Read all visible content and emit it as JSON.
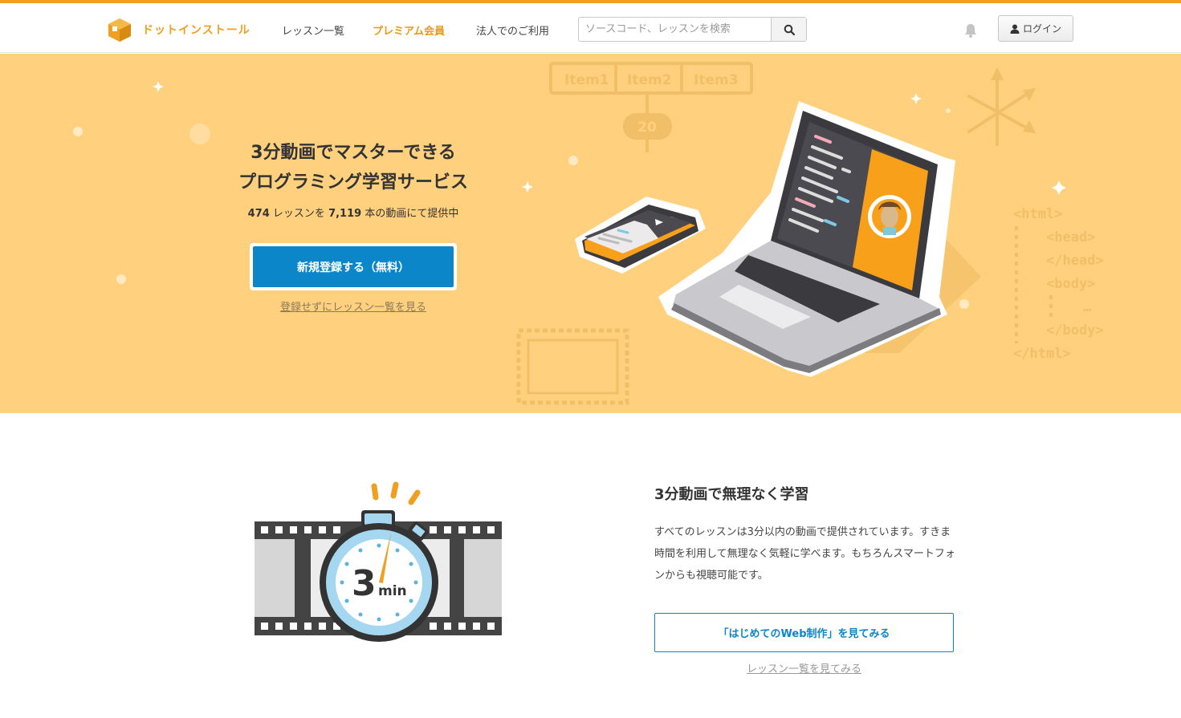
{
  "header": {
    "logo_text": "ドットインストール",
    "nav": [
      {
        "label": "レッスン一覧"
      },
      {
        "label": "プレミアム会員"
      },
      {
        "label": "法人でのご利用"
      }
    ],
    "search": {
      "placeholder": "ソースコード、レッスンを検索",
      "value": ""
    },
    "login_label": "ログイン"
  },
  "hero": {
    "title_line1": "3分動画でマスターできる",
    "title_line2": "プログラミング学習サービス",
    "lessons_count": "474",
    "text_a": " レッスンを ",
    "videos_count": "7,119",
    "text_b": " 本の動画にて提供中",
    "signup_label": "新規登録する（無料）",
    "browse_link": "登録せずにレッスン一覧を見る",
    "art": {
      "tabs": [
        "Item1",
        "Item2",
        "Item3"
      ],
      "badge": "20",
      "code_lines": [
        "<html>",
        "<head>",
        "</head>",
        "<body>",
        "…",
        "</body>",
        "</html>"
      ]
    }
  },
  "feature": {
    "title": "3分動画で無理なく学習",
    "body": "すべてのレッスンは3分以内の動画で提供されています。すきま時間を利用して無理なく気軽に学べます。もちろんスマートフォンからも視聴可能です。",
    "button_label": "「はじめてのWeb制作」を見てみる",
    "link_label": "レッスン一覧を見てみる",
    "stopwatch_number": "3",
    "stopwatch_unit": "min"
  },
  "colors": {
    "accent": "#f0a020",
    "hero_bg": "#ffd07d",
    "primary_button": "#0a86c9"
  }
}
